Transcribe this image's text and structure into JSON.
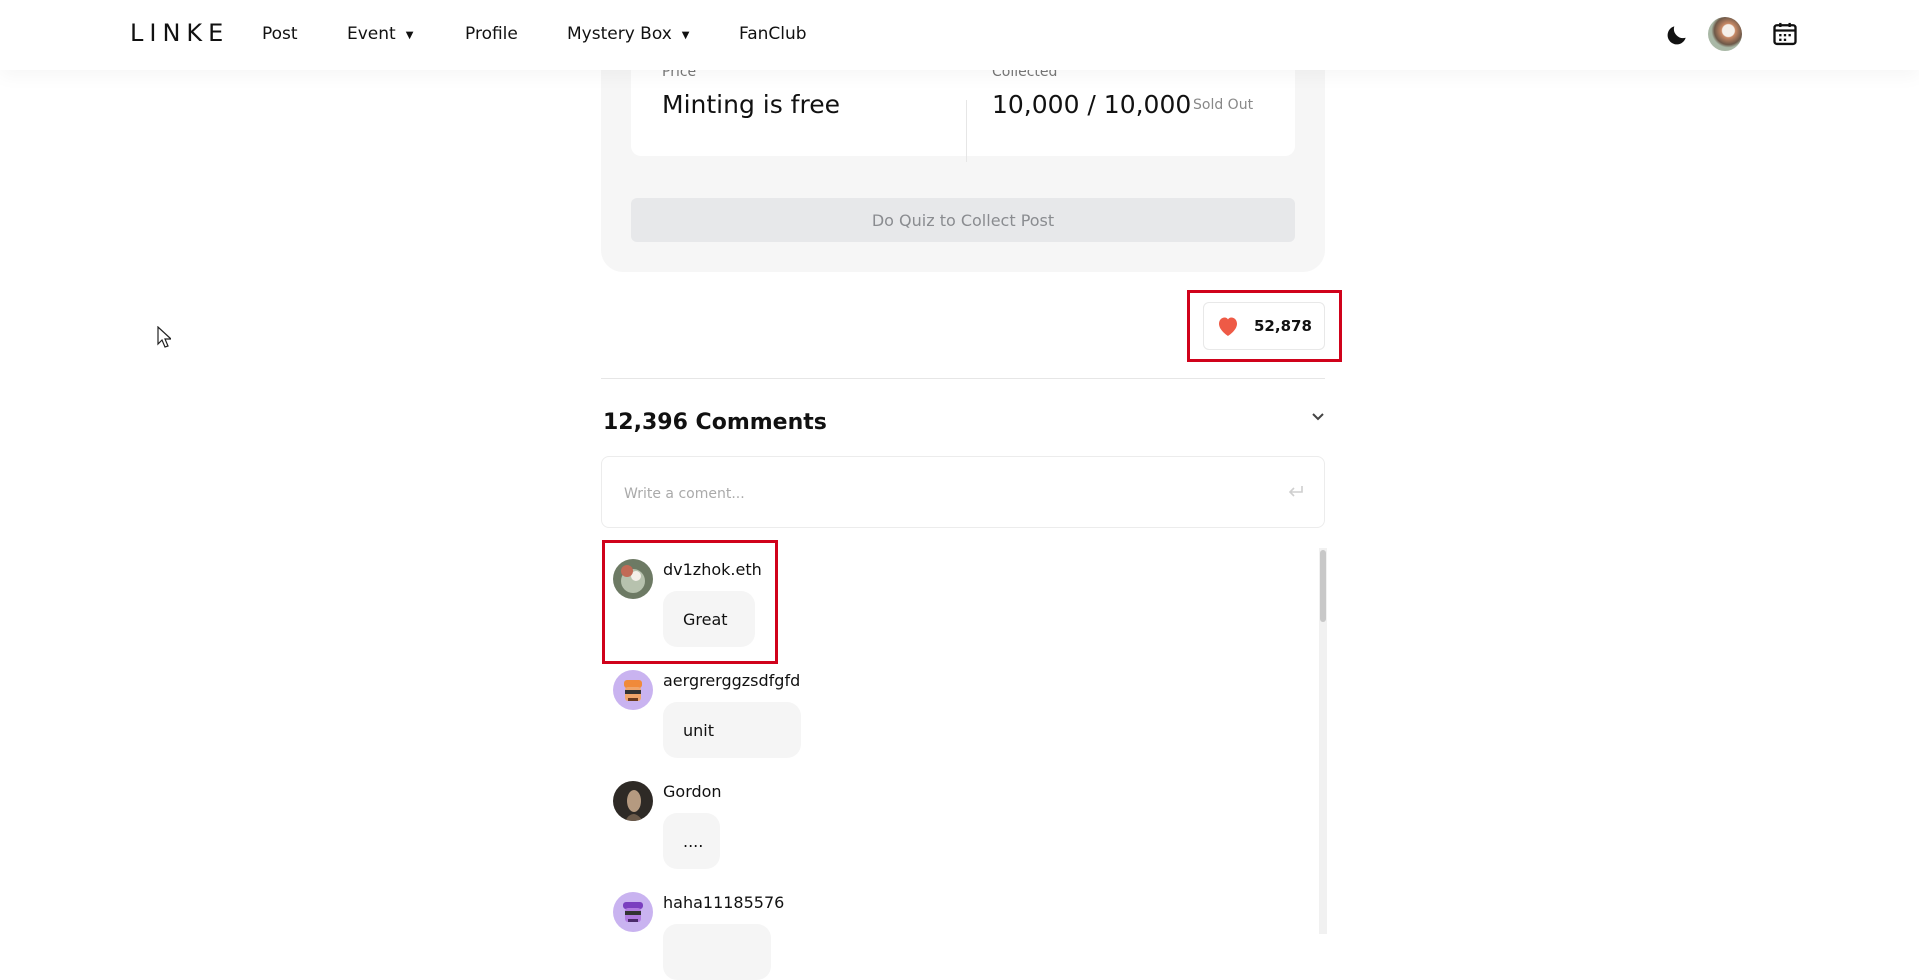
{
  "nav": {
    "logo": "LINKE",
    "items": [
      "Post",
      "Event",
      "Profile",
      "Mystery Box",
      "FanClub"
    ]
  },
  "post": {
    "price_label": "Price",
    "price_value": "Minting is free",
    "collected_label": "Collected",
    "collected_value": "10,000 / 10,000",
    "sold_out": "Sold Out",
    "quiz_button": "Do Quiz to Collect Post"
  },
  "likes": {
    "count": "52,878",
    "icon": "heart-icon",
    "color": "#ee5a46"
  },
  "comments": {
    "title": "12,396 Comments",
    "input_placeholder": "Write a coment...",
    "list": [
      {
        "user": "dv1zhok.eth",
        "text": "Great"
      },
      {
        "user": "aergrerggzsdfgfd",
        "text": "unit"
      },
      {
        "user": "Gordon",
        "text": "...."
      },
      {
        "user": "haha11185576",
        "text": ""
      }
    ]
  },
  "colors": {
    "highlight": "#d0021b",
    "accent": "#ee5a46"
  }
}
